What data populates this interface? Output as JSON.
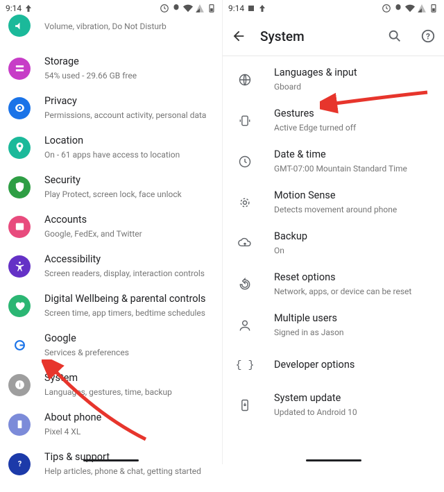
{
  "status": {
    "time": "9:14"
  },
  "left": {
    "items": [
      {
        "title": "Sound",
        "sub": "Volume, vibration, Do Not Disturb",
        "color": "#1BB99A",
        "icon": "sound"
      },
      {
        "title": "Storage",
        "sub": "54% used - 29.66 GB free",
        "color": "#C73DC7",
        "icon": "storage"
      },
      {
        "title": "Privacy",
        "sub": "Permissions, account activity, personal data",
        "color": "#1A73E8",
        "icon": "privacy"
      },
      {
        "title": "Location",
        "sub": "On - 61 apps have access to location",
        "color": "#1BB99A",
        "icon": "location"
      },
      {
        "title": "Security",
        "sub": "Play Protect, screen lock, face unlock",
        "color": "#2E9E44",
        "icon": "security"
      },
      {
        "title": "Accounts",
        "sub": "Google, FedEx, and Twitter",
        "color": "#E84B7D",
        "icon": "accounts"
      },
      {
        "title": "Accessibility",
        "sub": "Screen readers, display, interaction controls",
        "color": "#6431C6",
        "icon": "accessibility"
      },
      {
        "title": "Digital Wellbeing & parental controls",
        "sub": "Screen time, app timers, bedtime schedules",
        "color": "#2BB673",
        "icon": "wellbeing"
      },
      {
        "title": "Google",
        "sub": "Services & preferences",
        "color": "#ffffff",
        "icon": "google"
      },
      {
        "title": "System",
        "sub": "Languages, gestures, time, backup",
        "color": "#9E9E9E",
        "icon": "system"
      },
      {
        "title": "About phone",
        "sub": "Pixel 4 XL",
        "color": "#7C8BD9",
        "icon": "about"
      },
      {
        "title": "Tips & support",
        "sub": "Help articles, phone & chat, getting started",
        "color": "#1C3AA9",
        "icon": "help"
      }
    ]
  },
  "right": {
    "header": "System",
    "items": [
      {
        "title": "Languages & input",
        "sub": "Gboard",
        "icon": "globe"
      },
      {
        "title": "Gestures",
        "sub": "Active Edge turned off",
        "icon": "gesture"
      },
      {
        "title": "Date & time",
        "sub": "GMT-07:00 Mountain Standard Time",
        "icon": "clock"
      },
      {
        "title": "Motion Sense",
        "sub": "Detects movement around phone",
        "icon": "motion"
      },
      {
        "title": "Backup",
        "sub": "On",
        "icon": "backup"
      },
      {
        "title": "Reset options",
        "sub": "Network, apps, or device can be reset",
        "icon": "reset"
      },
      {
        "title": "Multiple users",
        "sub": "Signed in as Jason",
        "icon": "user"
      },
      {
        "title": "Developer options",
        "sub": "",
        "icon": "dev"
      },
      {
        "title": "System update",
        "sub": "Updated to Android 10",
        "icon": "update"
      }
    ]
  }
}
